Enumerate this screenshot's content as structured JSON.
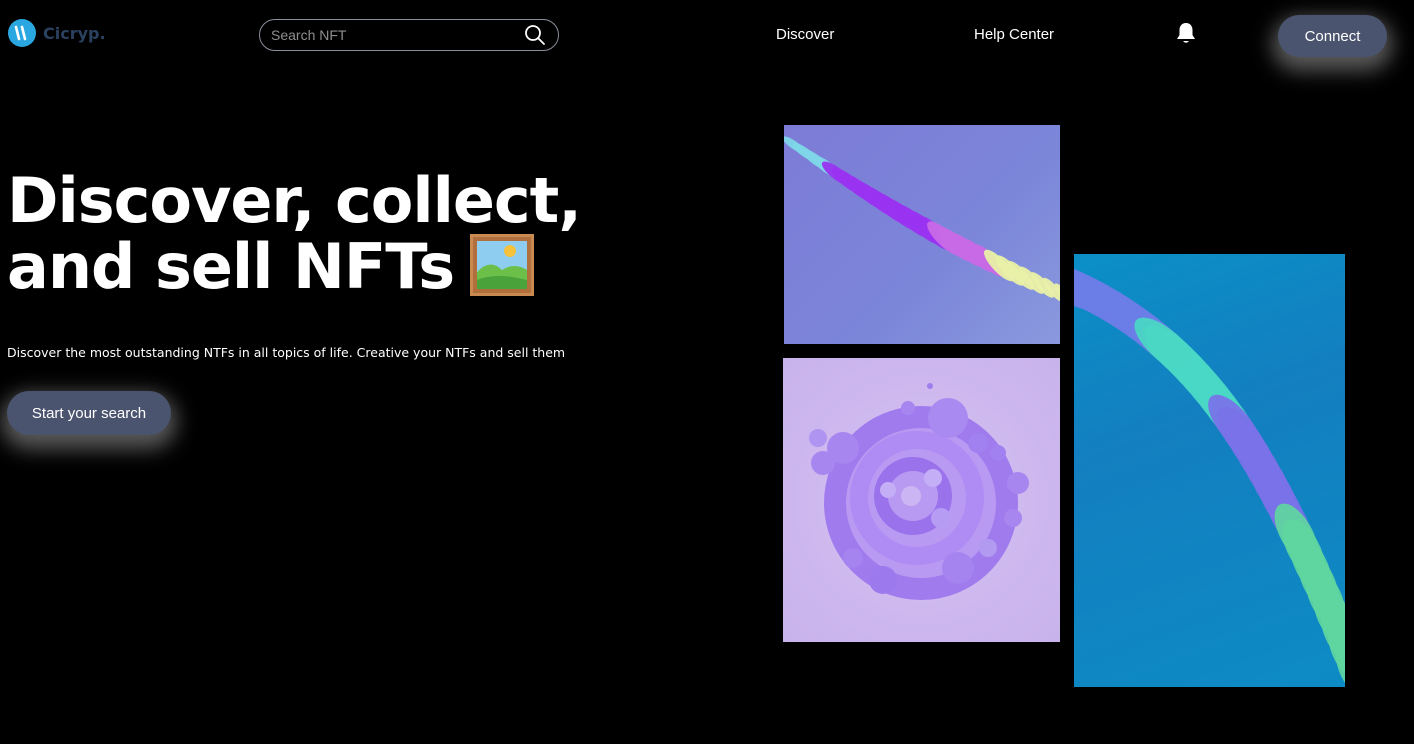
{
  "header": {
    "logo_text": "Cicryp.",
    "search": {
      "placeholder": "Search NFT",
      "value": ""
    },
    "nav": {
      "discover": "Discover",
      "help_center": "Help Center"
    },
    "connect_label": "Connect"
  },
  "hero": {
    "title_line_1": "Discover, collect,",
    "title_line_2": "and sell NFTs",
    "subtitle": "Discover the most outstanding NTFs in all topics of life. Creative your NTFs and sell them",
    "cta_label": "Start your search"
  },
  "icons": {
    "logo": "logo-icon",
    "search": "search-icon",
    "bell": "bell-icon",
    "frame": "framed-picture-icon"
  },
  "colors": {
    "background": "#000000",
    "button_bg": "#4b546e",
    "logo_accent": "#2aa7e0",
    "logo_text": "#2b4160"
  }
}
